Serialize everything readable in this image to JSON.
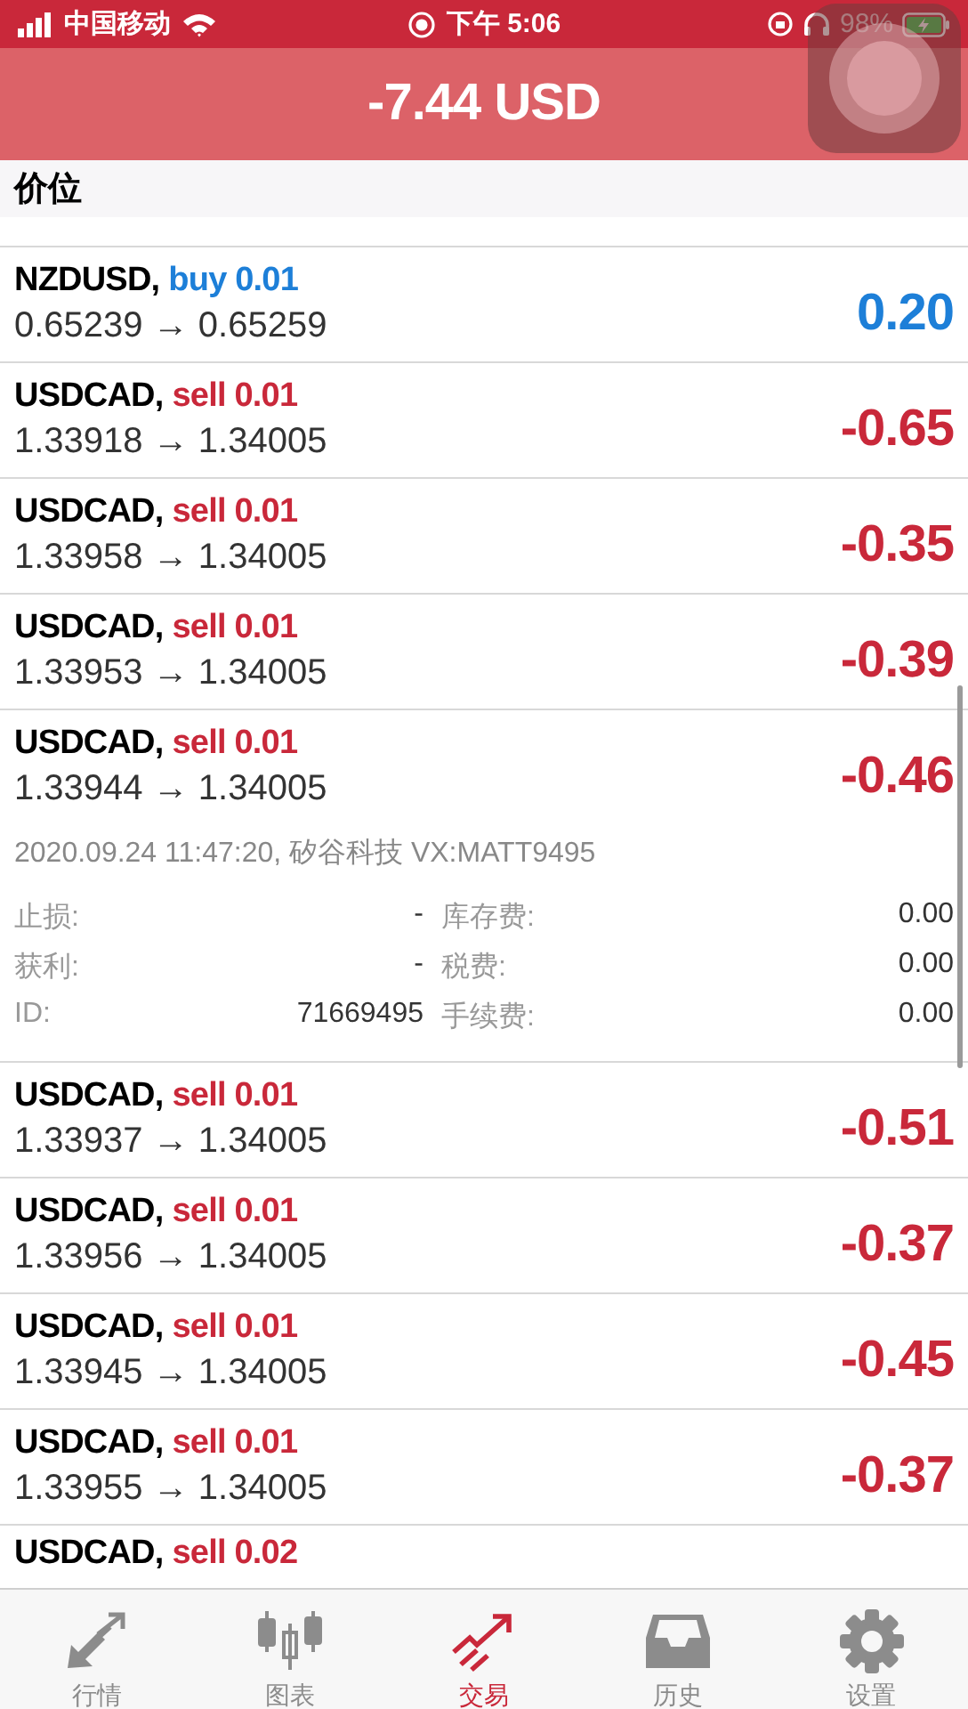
{
  "status_bar": {
    "carrier": "中国移动",
    "time": "下午 5:06",
    "battery": "98%"
  },
  "header": {
    "total": "-7.44 USD"
  },
  "section": {
    "title": "价位"
  },
  "positions": [
    {
      "symbol": "NZDUSD,",
      "kind": "buy",
      "order": "buy 0.01",
      "prices": "0.65239 → 0.65259",
      "profit": "0.20",
      "gain": true
    },
    {
      "symbol": "USDCAD,",
      "kind": "sell",
      "order": "sell 0.01",
      "prices": "1.33918 → 1.34005",
      "profit": "-0.65",
      "gain": false
    },
    {
      "symbol": "USDCAD,",
      "kind": "sell",
      "order": "sell 0.01",
      "prices": "1.33958 → 1.34005",
      "profit": "-0.35",
      "gain": false
    },
    {
      "symbol": "USDCAD,",
      "kind": "sell",
      "order": "sell 0.01",
      "prices": "1.33953 → 1.34005",
      "profit": "-0.39",
      "gain": false
    },
    {
      "symbol": "USDCAD,",
      "kind": "sell",
      "order": "sell 0.01",
      "prices": "1.33944 → 1.34005",
      "profit": "-0.46",
      "gain": false,
      "details": {
        "opened": "2020.09.24 11:47:20, 矽谷科技 VX:MATT9495",
        "fields": [
          {
            "label": "止损:",
            "value": "-",
            "label2": "库存费:",
            "value2": "0.00"
          },
          {
            "label": "获利:",
            "value": "-",
            "label2": "税费:",
            "value2": "0.00"
          },
          {
            "label": "ID:",
            "value": "71669495",
            "label2": "手续费:",
            "value2": "0.00"
          }
        ]
      }
    },
    {
      "symbol": "USDCAD,",
      "kind": "sell",
      "order": "sell 0.01",
      "prices": "1.33937 → 1.34005",
      "profit": "-0.51",
      "gain": false
    },
    {
      "symbol": "USDCAD,",
      "kind": "sell",
      "order": "sell 0.01",
      "prices": "1.33956 → 1.34005",
      "profit": "-0.37",
      "gain": false
    },
    {
      "symbol": "USDCAD,",
      "kind": "sell",
      "order": "sell 0.01",
      "prices": "1.33945 → 1.34005",
      "profit": "-0.45",
      "gain": false
    },
    {
      "symbol": "USDCAD,",
      "kind": "sell",
      "order": "sell 0.01",
      "prices": "1.33955 → 1.34005",
      "profit": "-0.37",
      "gain": false
    }
  ],
  "partial_position": {
    "symbol": "USDCAD,",
    "kind": "sell",
    "order": "sell 0.02"
  },
  "tabs": [
    {
      "kind": "quotes",
      "label": "行情",
      "selected": false
    },
    {
      "kind": "chart",
      "label": "图表",
      "selected": false
    },
    {
      "kind": "trade",
      "label": "交易",
      "selected": true
    },
    {
      "kind": "history",
      "label": "历史",
      "selected": false
    },
    {
      "kind": "settings",
      "label": "设置",
      "selected": false
    }
  ]
}
